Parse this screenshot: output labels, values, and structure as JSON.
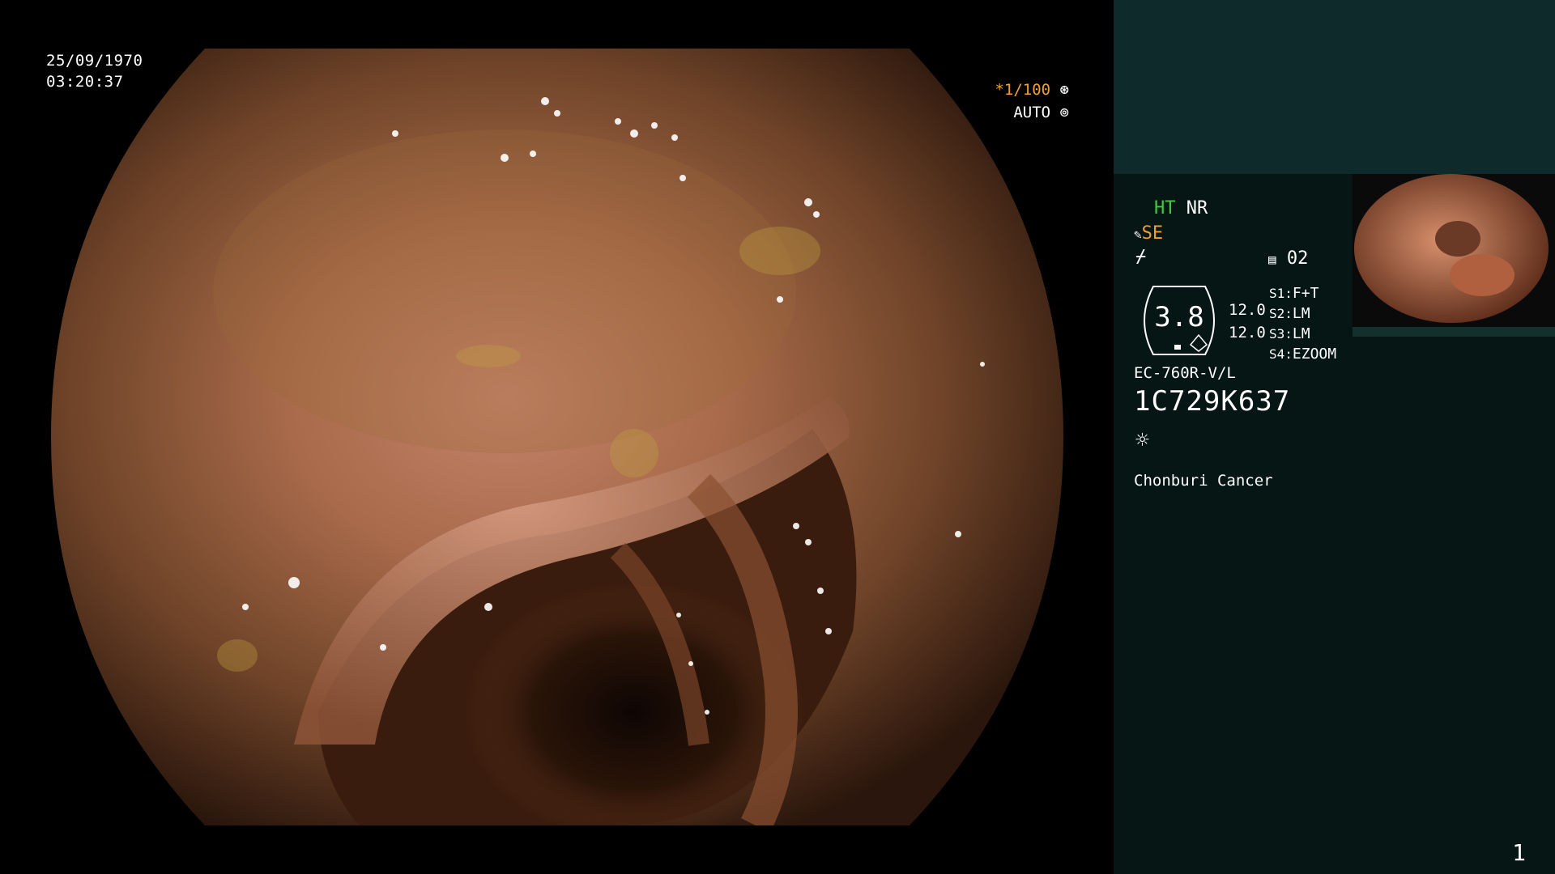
{
  "scope": {
    "date": "25/09/1970",
    "time": "03:20:37",
    "shutter": "*1/100",
    "iris": "AUTO"
  },
  "panel": {
    "mode_ht": "HT",
    "mode_nr": "NR",
    "se": "SE",
    "memory_no": "02",
    "gauge_value": "3.8",
    "level_1": "12.0",
    "level_2": "12.0",
    "switches": [
      {
        "key": "S1:",
        "value": "F+T"
      },
      {
        "key": "S2:",
        "value": "LM"
      },
      {
        "key": "S3:",
        "value": "LM"
      },
      {
        "key": "S4:",
        "value": "EZOOM"
      }
    ],
    "scope_model": "EC-760R-V/L",
    "serial": "1C729K637",
    "institution": "Chonburi Cancer",
    "frame_number": "1"
  },
  "icons": [
    "shutter-icon",
    "iris-icon",
    "brush-icon",
    "pen-icon",
    "memory-icon",
    "lamp-icon"
  ],
  "colors": {
    "accent_orange": "#f0a030",
    "accent_green": "#3ccf3c",
    "panel_bg": "#061614",
    "panel_top": "#0f2a2a"
  }
}
